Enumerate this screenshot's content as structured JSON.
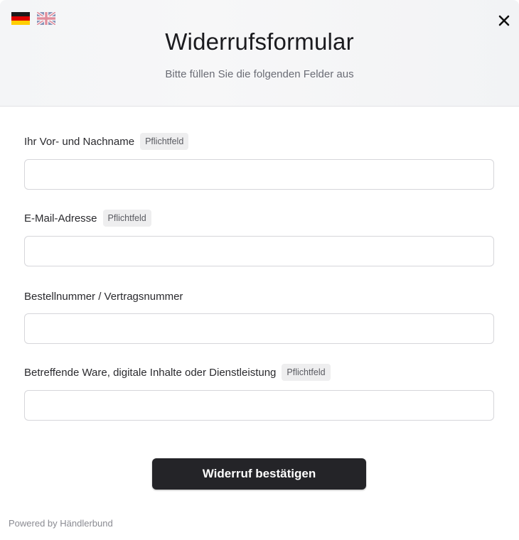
{
  "header": {
    "languages": [
      {
        "code": "de",
        "icon": "german-flag-icon"
      },
      {
        "code": "en",
        "icon": "uk-flag-icon"
      }
    ],
    "close_icon": "close-icon",
    "title": "Widerrufsformular",
    "subtitle": "Bitte füllen Sie die folgenden Felder aus"
  },
  "form": {
    "fields": [
      {
        "label": "Ihr Vor- und Nachname",
        "required_badge": "Pflichtfeld",
        "value": ""
      },
      {
        "label": "E-Mail-Adresse",
        "required_badge": "Pflichtfeld",
        "value": ""
      },
      {
        "label": "Bestellnummer / Vertragsnummer",
        "value": ""
      },
      {
        "label": "Betreffende Ware, digitale Inhalte oder Dienstleistung",
        "required_badge": "Pflichtfeld",
        "value": ""
      }
    ],
    "submit_label": "Widerruf bestätigen"
  },
  "footer": {
    "powered_by": "Powered by Händlerbund"
  },
  "colors": {
    "button_bg": "#242428",
    "header_bg": "#f4f5f7",
    "badge_bg": "#eeeeef"
  }
}
